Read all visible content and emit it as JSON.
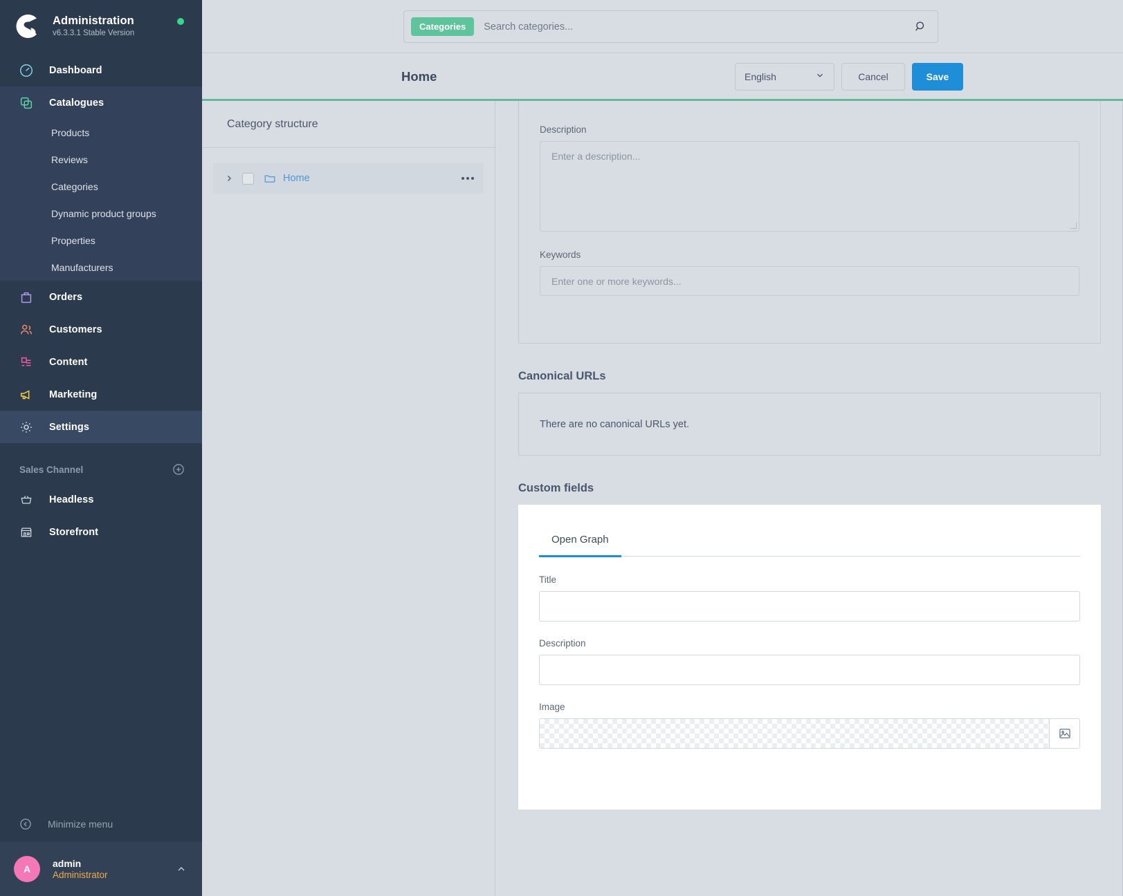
{
  "sidebar": {
    "brand": {
      "title": "Administration",
      "version": "v6.3.3.1 Stable Version",
      "status_color": "#37d88b"
    },
    "items": [
      {
        "label": "Dashboard",
        "icon": "gauge-icon"
      },
      {
        "label": "Catalogues",
        "icon": "catalogue-icon"
      },
      {
        "label": "Orders",
        "icon": "bag-icon"
      },
      {
        "label": "Customers",
        "icon": "users-icon"
      },
      {
        "label": "Content",
        "icon": "content-icon"
      },
      {
        "label": "Marketing",
        "icon": "megaphone-icon"
      },
      {
        "label": "Settings",
        "icon": "gear-icon"
      }
    ],
    "catalogue_children": [
      {
        "label": "Products"
      },
      {
        "label": "Reviews"
      },
      {
        "label": "Categories"
      },
      {
        "label": "Dynamic product groups"
      },
      {
        "label": "Properties"
      },
      {
        "label": "Manufacturers"
      }
    ],
    "sales_channel": {
      "heading": "Sales Channel",
      "add_icon": "plus-circle-icon",
      "channels": [
        {
          "label": "Headless",
          "icon": "basket-icon"
        },
        {
          "label": "Storefront",
          "icon": "store-icon"
        }
      ]
    },
    "minimize": {
      "label": "Minimize menu",
      "icon": "collapse-icon"
    },
    "user": {
      "initial": "A",
      "name": "admin",
      "role": "Administrator",
      "avatar_color": "#f477b8",
      "role_color": "#eeab4c"
    }
  },
  "search": {
    "scope_chip": "Categories",
    "placeholder": "Search categories...",
    "value": "",
    "icon": "search-icon",
    "chip_color": "#5ec49b"
  },
  "toolbar": {
    "title": "Home",
    "language": "English",
    "cancel_label": "Cancel",
    "save_label": "Save",
    "save_color": "#1e8ed8",
    "accent_color": "#67b79a"
  },
  "tree": {
    "heading": "Category structure",
    "rows": [
      {
        "label": "Home",
        "icon": "folder-icon",
        "caret": "chevron-right-icon",
        "more": "ellipsis-icon"
      }
    ]
  },
  "seo_card": {
    "description": {
      "label": "Description",
      "placeholder": "Enter a description...",
      "value": ""
    },
    "keywords": {
      "label": "Keywords",
      "placeholder": "Enter one or more keywords...",
      "value": ""
    }
  },
  "canonical": {
    "title": "Canonical URLs",
    "empty_text": "There are no canonical URLs yet."
  },
  "custom_fields": {
    "title": "Custom fields",
    "tabs": [
      {
        "label": "Open Graph",
        "active": true
      }
    ],
    "fields": [
      {
        "label": "Title",
        "type": "text",
        "value": ""
      },
      {
        "label": "Description",
        "type": "text",
        "value": ""
      },
      {
        "label": "Image",
        "type": "image",
        "value": "",
        "button_icon": "image-icon"
      }
    ]
  }
}
